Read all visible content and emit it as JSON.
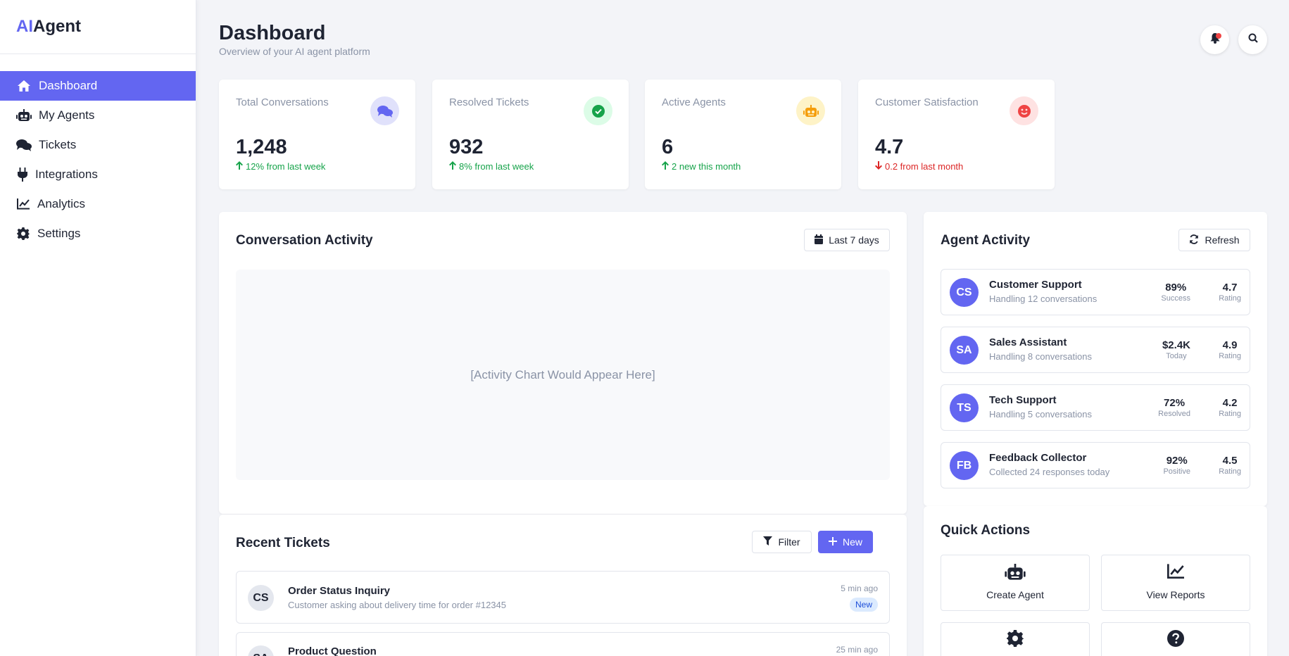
{
  "brand": {
    "prefix": "AI",
    "rest": "Agent"
  },
  "nav": [
    {
      "label": "Dashboard",
      "icon": "home-icon",
      "active": true
    },
    {
      "label": "My Agents",
      "icon": "robot-icon"
    },
    {
      "label": "Tickets",
      "icon": "comments-icon"
    },
    {
      "label": "Integrations",
      "icon": "plug-icon"
    },
    {
      "label": "Analytics",
      "icon": "chart-line-icon"
    },
    {
      "label": "Settings",
      "icon": "gear-icon"
    }
  ],
  "header": {
    "title": "Dashboard",
    "subtitle": "Overview of your AI agent platform"
  },
  "stats": [
    {
      "label": "Total Conversations",
      "value": "1,248",
      "change": "12% from last week",
      "direction": "up",
      "icon": "comments-icon",
      "icon_color": "#6366f1",
      "icon_bg": "#e0e1fb"
    },
    {
      "label": "Resolved Tickets",
      "value": "932",
      "change": "8% from last week",
      "direction": "up",
      "icon": "check-circle-icon",
      "icon_color": "#16a34a",
      "icon_bg": "#dcfce7"
    },
    {
      "label": "Active Agents",
      "value": "6",
      "change": "2 new this month",
      "direction": "up",
      "icon": "robot-icon",
      "icon_color": "#f59e0b",
      "icon_bg": "#fef3c7"
    },
    {
      "label": "Customer Satisfaction",
      "value": "4.7",
      "change": "0.2 from last month",
      "direction": "down",
      "icon": "smile-icon",
      "icon_color": "#ef4444",
      "icon_bg": "#fee2e2"
    }
  ],
  "activity": {
    "title": "Conversation Activity",
    "range_button": "Last 7 days",
    "placeholder": "[Activity Chart Would Appear Here]"
  },
  "agents": {
    "title": "Agent Activity",
    "refresh_button": "Refresh",
    "items": [
      {
        "initials": "CS",
        "name": "Customer Support",
        "desc": "Handling 12 conversations",
        "m1_value": "89%",
        "m1_label": "Success",
        "m2_value": "4.7",
        "m2_label": "Rating"
      },
      {
        "initials": "SA",
        "name": "Sales Assistant",
        "desc": "Handling 8 conversations",
        "m1_value": "$2.4K",
        "m1_label": "Today",
        "m2_value": "4.9",
        "m2_label": "Rating"
      },
      {
        "initials": "TS",
        "name": "Tech Support",
        "desc": "Handling 5 conversations",
        "m1_value": "72%",
        "m1_label": "Resolved",
        "m2_value": "4.2",
        "m2_label": "Rating"
      },
      {
        "initials": "FB",
        "name": "Feedback Collector",
        "desc": "Collected 24 responses today",
        "m1_value": "92%",
        "m1_label": "Positive",
        "m2_value": "4.5",
        "m2_label": "Rating"
      }
    ]
  },
  "tickets": {
    "title": "Recent Tickets",
    "filter_button": "Filter",
    "new_button": "New",
    "items": [
      {
        "initials": "CS",
        "title": "Order Status Inquiry",
        "desc": "Customer asking about delivery time for order #12345",
        "time": "5 min ago",
        "badge": "New"
      },
      {
        "initials": "SA",
        "title": "Product Question",
        "desc": "",
        "time": "25 min ago",
        "badge": ""
      }
    ]
  },
  "quick_actions": {
    "title": "Quick Actions",
    "items": [
      {
        "label": "Create Agent",
        "icon": "robot-icon"
      },
      {
        "label": "View Reports",
        "icon": "chart-line-icon"
      },
      {
        "label": "",
        "icon": "gear-icon"
      },
      {
        "label": "",
        "icon": "question-circle-icon"
      }
    ]
  }
}
